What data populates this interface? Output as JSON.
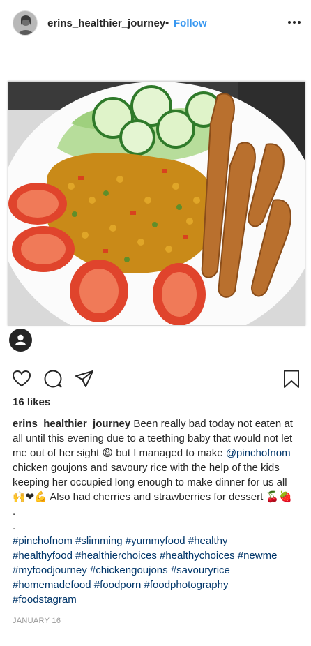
{
  "header": {
    "username": "erins_healthier_journey",
    "separator": "•",
    "follow_label": "Follow",
    "more_icon": "more-horizontal-icon"
  },
  "post": {
    "photo_alt": "plate of chicken goujons, savoury rice, cucumber, lettuce and tomatoes",
    "likes_text": "16 likes",
    "caption": {
      "username": "erins_healthier_journey",
      "text_1": "Been really bad today not eaten at all until this evening due to a teething baby that would not let me out of her sight 😩 but I managed to make",
      "mention": "@pinchofnom",
      "text_2": "chicken goujons and savoury rice with the help of the kids keeping her occupied long enough to make dinner for us all 🙌❤💪 Also had cherries and strawberries for dessert 🍒🍓",
      "dot_1": ".",
      "dot_2": ".",
      "hashtags": [
        "#pinchofnom",
        "#slimming",
        "#yummyfood",
        "#healthy",
        "#healthyfood",
        "#healthierchoices",
        "#healthychoices",
        "#newme",
        "#myfoodjourney",
        "#chickengoujons",
        "#savouryrice",
        "#homemadefood",
        "#foodporn",
        "#foodphotography",
        "#foodstagram"
      ]
    },
    "date": "JANUARY 16"
  },
  "icons": {
    "like": "heart-icon",
    "comment": "comment-icon",
    "share": "share-icon",
    "save": "bookmark-icon",
    "tag": "user-tag-icon"
  },
  "colors": {
    "link_blue": "#3897f0",
    "hashtag_blue": "#003569",
    "text": "#262626",
    "muted": "#999999"
  }
}
